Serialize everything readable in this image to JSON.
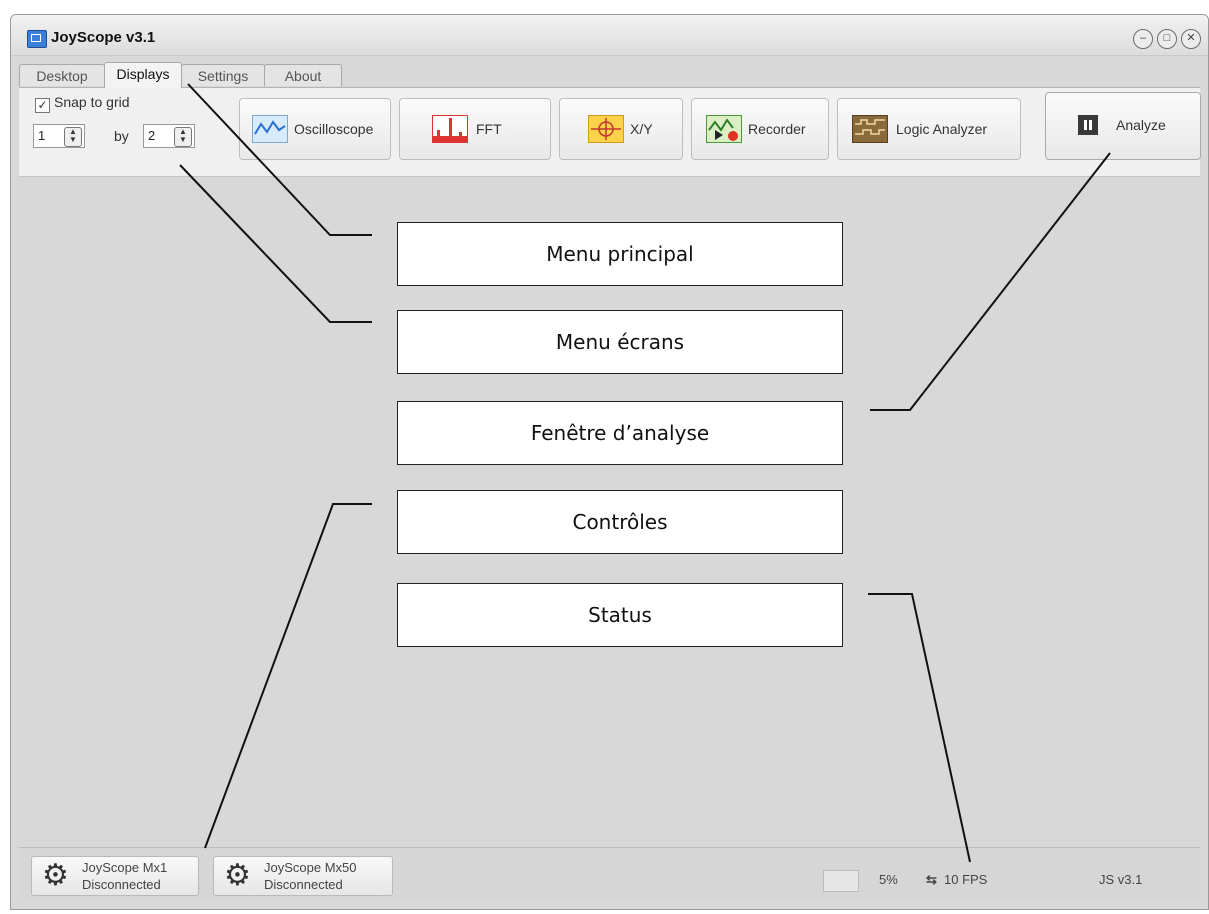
{
  "window": {
    "title": "JoyScope v3.1"
  },
  "tabs": [
    "Desktop",
    "Displays",
    "Settings",
    "About"
  ],
  "toolbar": {
    "snap_label": "Snap to grid",
    "snap_checked": true,
    "rows_value": "1",
    "by_label": "by",
    "cols_value": "2",
    "buttons": [
      "Oscilloscope",
      "FFT",
      "X/Y",
      "Recorder",
      "Logic Analyzer"
    ],
    "analyze_label": "Analyze"
  },
  "callouts": [
    "Menu principal",
    "Menu écrans",
    "Fenêtre d’analyse",
    "Contrôles",
    "Status"
  ],
  "status": {
    "devices": [
      {
        "name": "JoyScope Mx1",
        "state": "Disconnected"
      },
      {
        "name": "JoyScope Mx50",
        "state": "Disconnected"
      }
    ],
    "cpu": "5%",
    "fps": "10 FPS",
    "version": "JS v3.1"
  },
  "colors": {
    "window_bg": "#d8d8d8",
    "toolbar_bg": "#f0f0f0",
    "callout_border": "#222222"
  }
}
